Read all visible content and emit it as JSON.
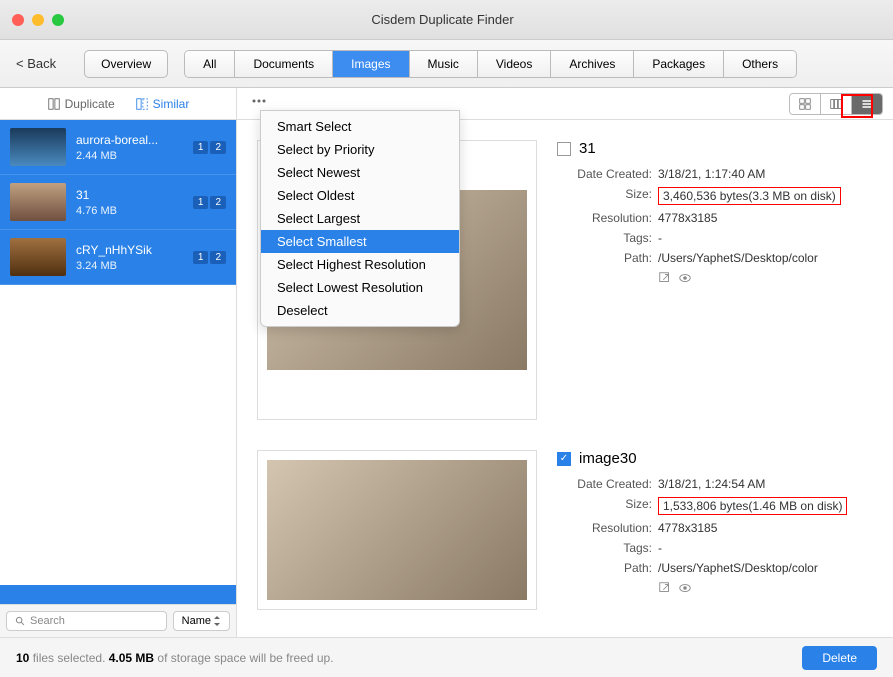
{
  "window": {
    "title": "Cisdem Duplicate Finder"
  },
  "toolbar": {
    "back": "< Back",
    "overview": "Overview",
    "tabs": [
      "All",
      "Documents",
      "Images",
      "Music",
      "Videos",
      "Archives",
      "Packages",
      "Others"
    ],
    "active_tab": 2
  },
  "sidebar": {
    "tabs": {
      "duplicate": "Duplicate",
      "similar": "Similar"
    },
    "items": [
      {
        "name": "aurora-boreal...",
        "size": "2.44 MB",
        "b1": "1",
        "b2": "2"
      },
      {
        "name": "31",
        "size": "4.76 MB",
        "b1": "1",
        "b2": "2"
      },
      {
        "name": "cRY_nHhYSik",
        "size": "3.24 MB",
        "b1": "1",
        "b2": "2"
      }
    ],
    "search_placeholder": "Search",
    "sort": "Name"
  },
  "menu": {
    "items": [
      "Smart Select",
      "Select by Priority",
      "Select Newest",
      "Select Oldest",
      "Select Largest",
      "Select Smallest",
      "Select Highest Resolution",
      "Select Lowest Resolution",
      "Deselect"
    ],
    "selected_index": 5
  },
  "detail": {
    "items": [
      {
        "checked": false,
        "title": "31",
        "rows": {
          "date_label": "Date Created:",
          "date": "3/18/21, 1:17:40 AM",
          "size_label": "Size:",
          "size": "3,460,536 bytes(3.3 MB on disk)",
          "res_label": "Resolution:",
          "res": "4778x3185",
          "tags_label": "Tags:",
          "tags": "-",
          "path_label": "Path:",
          "path": "/Users/YaphetS/Desktop/color"
        }
      },
      {
        "checked": true,
        "title": "image30",
        "rows": {
          "date_label": "Date Created:",
          "date": "3/18/21, 1:24:54 AM",
          "size_label": "Size:",
          "size": "1,533,806 bytes(1.46 MB on disk)",
          "res_label": "Resolution:",
          "res": "4778x3185",
          "tags_label": "Tags:",
          "tags": "-",
          "path_label": "Path:",
          "path": "/Users/YaphetS/Desktop/color"
        }
      }
    ]
  },
  "footer": {
    "count": "10",
    "mid1": " files selected. ",
    "size": "4.05 MB",
    "mid2": " of storage space will be freed up.",
    "delete": "Delete"
  }
}
